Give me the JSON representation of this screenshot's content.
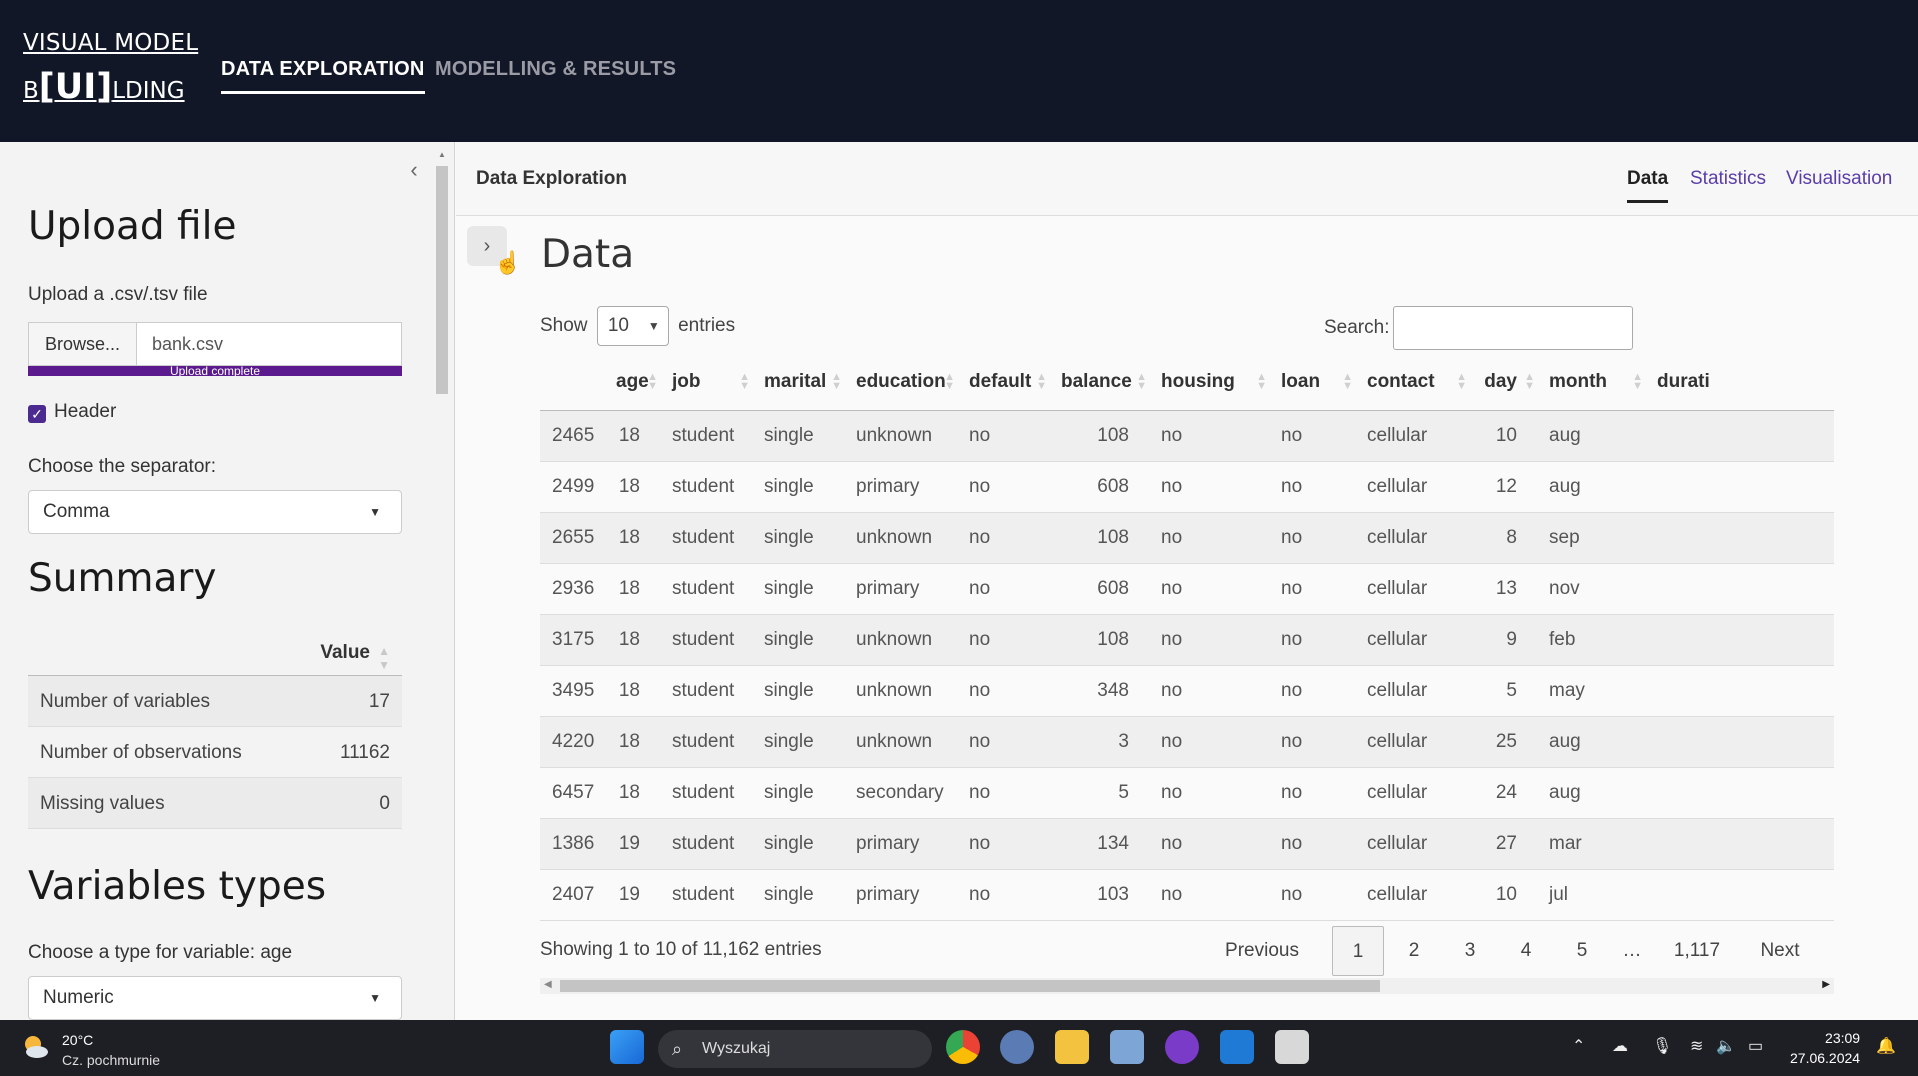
{
  "navbar": {
    "brand_line1": "VISUAL MODEL",
    "brand_line2_a": "B",
    "brand_line2_b": "[UI]",
    "brand_line2_c": "LDING",
    "links": [
      "DATA EXPLORATION",
      "MODELLING & RESULTS"
    ]
  },
  "sidebar": {
    "upload_title": "Upload file",
    "upload_label": "Upload a .csv/.tsv file",
    "browse_label": "Browse...",
    "file_name": "bank.csv",
    "progress_text": "Upload complete",
    "progress_value": 1.0,
    "header_checkbox_label": "Header",
    "header_checked": true,
    "separator_label": "Choose the separator:",
    "separator_value": "Comma",
    "summary_title": "Summary",
    "summary_value_header": "Value",
    "summary_rows": [
      {
        "k": "Number of variables",
        "v": "17"
      },
      {
        "k": "Number of observations",
        "v": "11162"
      },
      {
        "k": "Missing values",
        "v": "0"
      }
    ],
    "vartypes_title": "Variables types",
    "vartypes_label": "Choose a type for variable: age",
    "vartypes_value": "Numeric"
  },
  "main": {
    "card_title": "Data Exploration",
    "tabs": [
      "Data",
      "Statistics",
      "Visualisation"
    ],
    "active_tab": "Data",
    "heading": "Data",
    "show_label": "Show",
    "entries_label": "entries",
    "page_length": "10",
    "search_label": "Search:",
    "search_value": "",
    "columns": [
      "",
      "age",
      "job",
      "marital",
      "education",
      "default",
      "balance",
      "housing",
      "loan",
      "contact",
      "day",
      "month",
      "durati"
    ],
    "rows": [
      [
        "2465",
        "18",
        "student",
        "single",
        "unknown",
        "no",
        "108",
        "no",
        "no",
        "cellular",
        "10",
        "aug",
        ""
      ],
      [
        "2499",
        "18",
        "student",
        "single",
        "primary",
        "no",
        "608",
        "no",
        "no",
        "cellular",
        "12",
        "aug",
        ""
      ],
      [
        "2655",
        "18",
        "student",
        "single",
        "unknown",
        "no",
        "108",
        "no",
        "no",
        "cellular",
        "8",
        "sep",
        ""
      ],
      [
        "2936",
        "18",
        "student",
        "single",
        "primary",
        "no",
        "608",
        "no",
        "no",
        "cellular",
        "13",
        "nov",
        ""
      ],
      [
        "3175",
        "18",
        "student",
        "single",
        "unknown",
        "no",
        "108",
        "no",
        "no",
        "cellular",
        "9",
        "feb",
        ""
      ],
      [
        "3495",
        "18",
        "student",
        "single",
        "unknown",
        "no",
        "348",
        "no",
        "no",
        "cellular",
        "5",
        "may",
        ""
      ],
      [
        "4220",
        "18",
        "student",
        "single",
        "unknown",
        "no",
        "3",
        "no",
        "no",
        "cellular",
        "25",
        "aug",
        ""
      ],
      [
        "6457",
        "18",
        "student",
        "single",
        "secondary",
        "no",
        "5",
        "no",
        "no",
        "cellular",
        "24",
        "aug",
        ""
      ],
      [
        "1386",
        "19",
        "student",
        "single",
        "primary",
        "no",
        "134",
        "no",
        "no",
        "cellular",
        "27",
        "mar",
        ""
      ],
      [
        "2407",
        "19",
        "student",
        "single",
        "primary",
        "no",
        "103",
        "no",
        "no",
        "cellular",
        "10",
        "jul",
        ""
      ]
    ],
    "info": "Showing 1 to 10 of 11,162 entries",
    "pager": [
      "Previous",
      "1",
      "2",
      "3",
      "4",
      "5",
      "…",
      "1,117",
      "Next"
    ],
    "current_page": "1"
  },
  "taskbar": {
    "temp": "20°C",
    "weather": "Cz. pochmurnie",
    "search_placeholder": "Wyszukaj",
    "time": "23:09",
    "date": "27.06.2024"
  }
}
